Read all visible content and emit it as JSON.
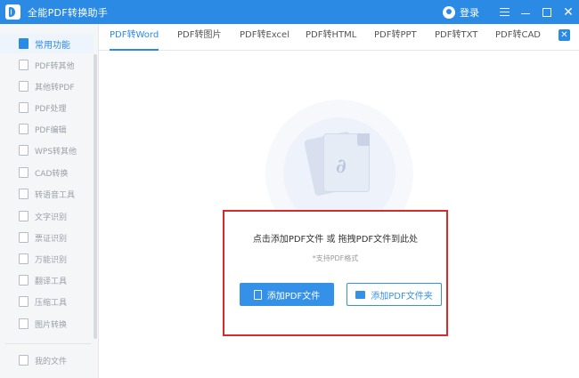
{
  "window": {
    "title": "全能PDF转换助手",
    "login_label": "登录"
  },
  "tabs": [
    {
      "label": "PDF转Word",
      "active": true
    },
    {
      "label": "PDF转图片",
      "active": false
    },
    {
      "label": "PDF转Excel",
      "active": false
    },
    {
      "label": "PDF转HTML",
      "active": false
    },
    {
      "label": "PDF转PPT",
      "active": false
    },
    {
      "label": "PDF转TXT",
      "active": false
    },
    {
      "label": "PDF转CAD",
      "active": false
    }
  ],
  "sidebar": {
    "items": [
      {
        "label": "常用功能",
        "active": true
      },
      {
        "label": "PDF转其他",
        "active": false
      },
      {
        "label": "其他转PDF",
        "active": false
      },
      {
        "label": "PDF处理",
        "active": false
      },
      {
        "label": "PDF编辑",
        "active": false
      },
      {
        "label": "WPS转其他",
        "active": false
      },
      {
        "label": "CAD转换",
        "active": false
      },
      {
        "label": "转语音工具",
        "active": false
      },
      {
        "label": "文字识别",
        "active": false
      },
      {
        "label": "票证识别",
        "active": false
      },
      {
        "label": "万能识别",
        "active": false
      },
      {
        "label": "翻译工具",
        "active": false
      },
      {
        "label": "压缩工具",
        "active": false
      },
      {
        "label": "图片转换",
        "active": false
      }
    ],
    "footer_item": "我的文件"
  },
  "dropzone": {
    "title": "点击添加PDF文件 或 拖拽PDF文件到此处",
    "hint": "*支持PDF格式",
    "add_file_label": "添加PDF文件",
    "add_folder_label": "添加PDF文件夹"
  },
  "colors": {
    "accent": "#2b8ae4",
    "highlight_border": "#d72a2a"
  }
}
